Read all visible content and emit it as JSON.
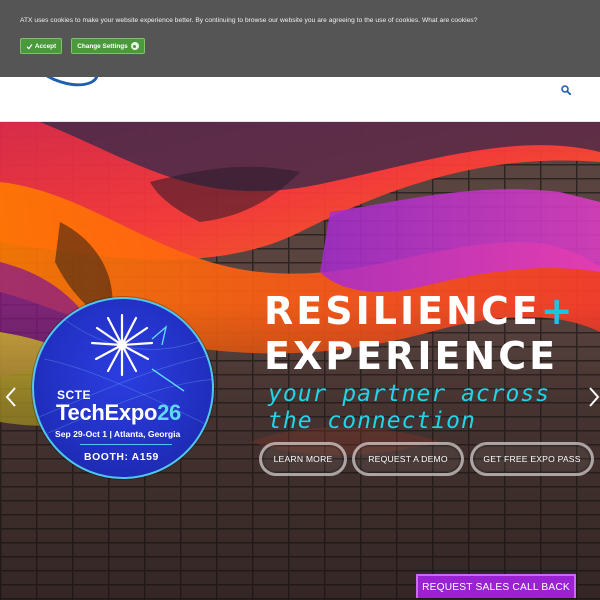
{
  "cookie_bar": {
    "message": "ATX uses cookies to make your website experience better. By continuing to browse our website you are agreeing to the use of cookies.",
    "link": "What are cookies?",
    "accept_label": "Accept",
    "change_label": "Change Settings"
  },
  "header": {
    "search_icon": "search-icon"
  },
  "hero": {
    "headline_line1": "RESILIENCE",
    "headline_plus": "+",
    "headline_line2": "EXPERIENCE",
    "tagline_line1": "your partner across",
    "tagline_line2": "the connection",
    "buttons": [
      {
        "label": "LEARN MORE"
      },
      {
        "label": "REQUEST A DEMO"
      },
      {
        "label": "GET FREE EXPO PASS"
      }
    ],
    "prev_icon": "chevron-left-icon",
    "next_icon": "chevron-right-icon"
  },
  "badge": {
    "org": "SCTE",
    "event": "TechExpo",
    "event_year": "26",
    "dates": "Sep 29-Oct 1 | Atlanta, Georgia",
    "booth": "BOOTH: A159"
  },
  "sales_button": {
    "label": "REQUEST SALES CALL BACK"
  },
  "colors": {
    "cookie_bg": "#555555",
    "accept_green": "#4a9a3c",
    "accent_cyan": "#21d4e8",
    "badge_blue": "#2231c4",
    "sales_purple": "#9b22d2"
  }
}
